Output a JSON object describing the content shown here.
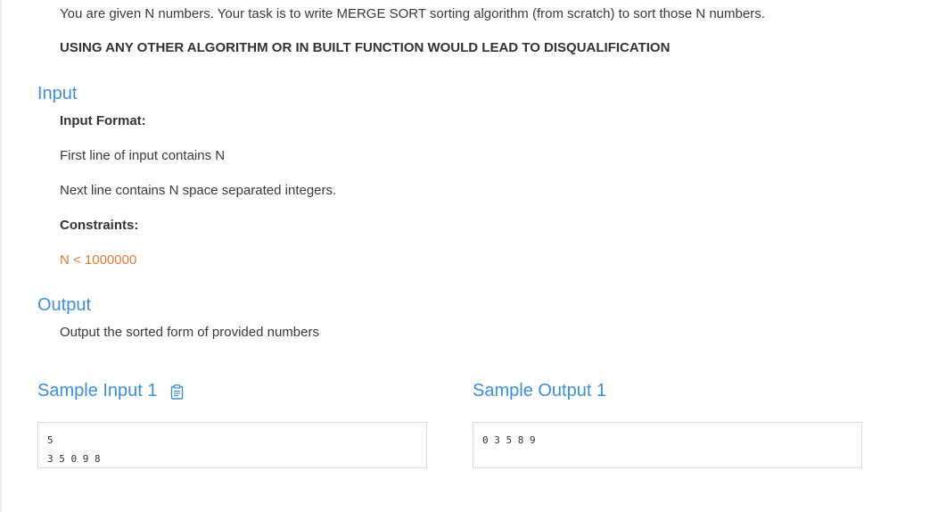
{
  "statement": {
    "intro": "You are given N numbers. Your task is to write MERGE SORT sorting algorithm (from scratch) to sort those N numbers.",
    "warning": "USING ANY OTHER ALGORITHM OR IN BUILT FUNCTION WOULD LEAD TO DISQUALIFICATION"
  },
  "input_section": {
    "heading": "Input",
    "format_label": "Input Format:",
    "line1": "First line of input contains N",
    "line2": "Next line contains N space separated integers.",
    "constraints_label": "Constraints:",
    "constraint": "N < 1000000"
  },
  "output_section": {
    "heading": "Output",
    "description": "Output the sorted form of provided numbers"
  },
  "samples": {
    "input_heading": "Sample Input 1",
    "input_lines": [
      "5",
      "3 5 0 9 8"
    ],
    "output_heading": "Sample Output 1",
    "output_lines": [
      "0 3 5 8 9"
    ],
    "copy_icon": "clipboard-icon",
    "accent_color": "#3d8fd6"
  }
}
